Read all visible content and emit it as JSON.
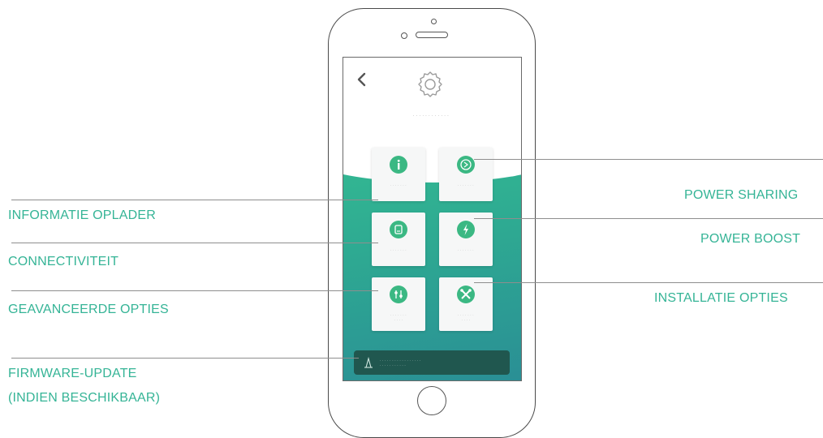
{
  "callouts": {
    "info": "INFORMATIE OPLADER",
    "connectivity": "CONNECTIVITEIT",
    "advanced": "GEAVANCEERDE OPTIES",
    "firmware_line1": "FIRMWARE-UPDATE",
    "firmware_line2": "(INDIEN BESCHIKBAAR)",
    "power_sharing": "POWER SHARING",
    "power_boost": "POWER BOOST",
    "install": "INSTALLATIE OPTIES"
  },
  "colors": {
    "accent": "#35b496",
    "gradient_top": "#38c793",
    "gradient_bottom": "#2a8f95",
    "update_bar": "#20574f"
  },
  "icons": {
    "back": "chevron-left-icon",
    "settings": "gear-icon",
    "info": "info-icon",
    "power_sharing": "power-sharing-icon",
    "connectivity": "connectivity-icon",
    "power_boost": "bolt-icon",
    "advanced": "advanced-options-icon",
    "install": "tools-icon",
    "firmware": "firmware-update-icon"
  }
}
